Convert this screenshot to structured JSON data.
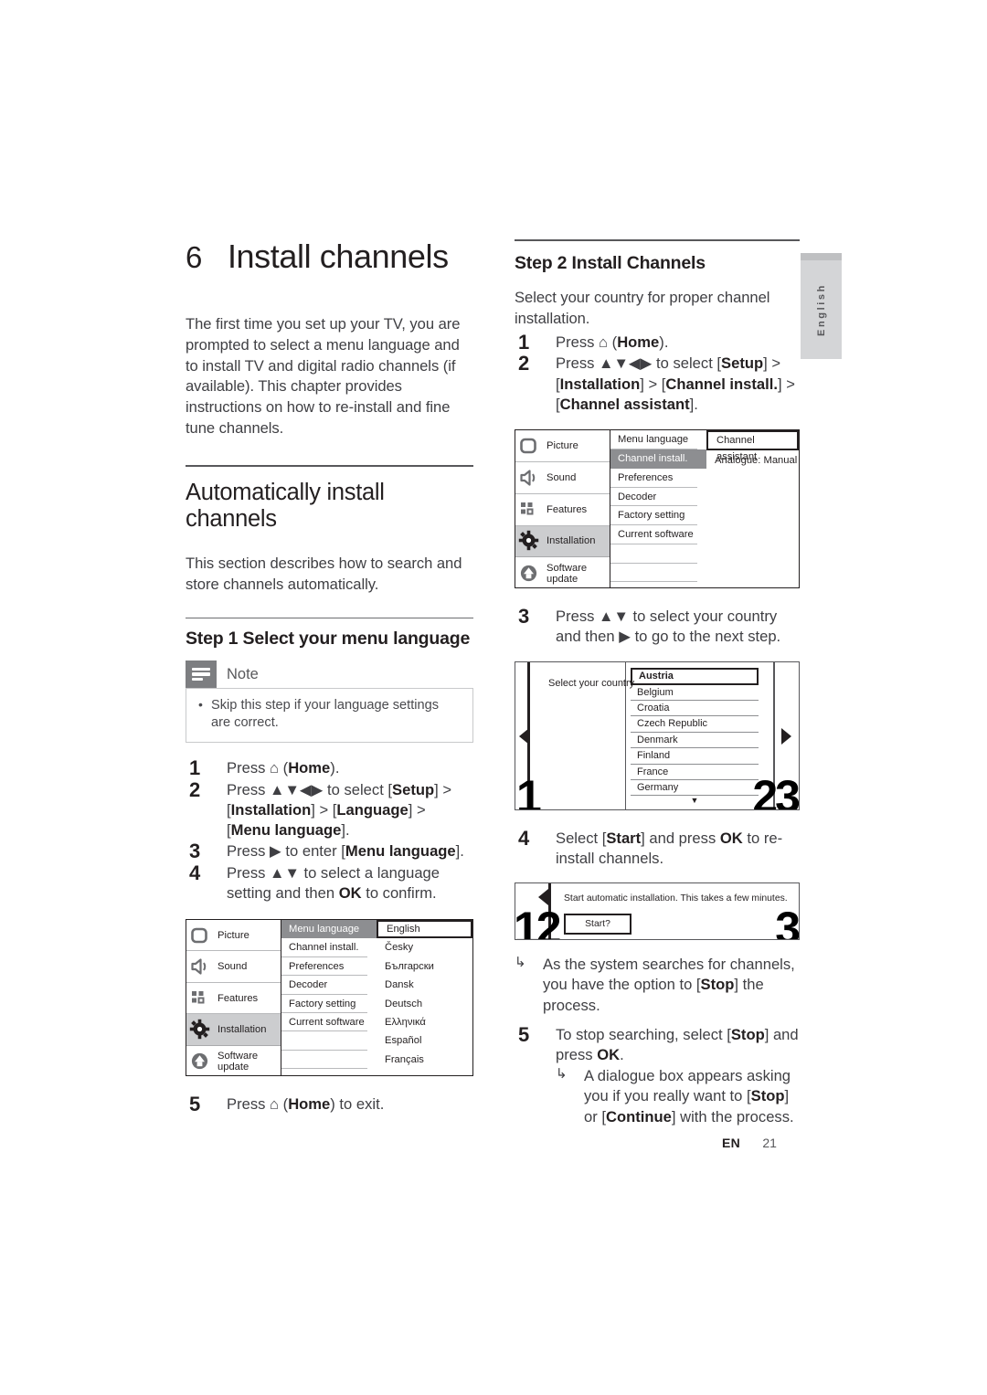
{
  "document": {
    "chapter_number": "6",
    "chapter_title": "Install channels",
    "intro": "The first time you set up your TV, you are prompted to select a menu language and to install TV and digital radio channels (if available). This chapter provides instructions on how to re-install and fine tune channels."
  },
  "left_column": {
    "section_title": "Automatically install channels",
    "section_intro": "This section describes how to search and store channels automatically.",
    "step_heading": "Step 1 Select your menu language",
    "note": {
      "label": "Note",
      "items": [
        "Skip this step if your language settings are correct."
      ]
    },
    "steps": [
      {
        "n": "1",
        "html": "Press ⌂ (<b>Home</b>)."
      },
      {
        "n": "2",
        "html": "Press ▲▼◀▶ to select [<b>Setup</b>] &gt; [<b>Installation</b>] &gt; [<b>Language</b>] &gt; [<b>Menu language</b>]."
      },
      {
        "n": "3",
        "html": "Press ▶ to enter [<b>Menu language</b>]."
      },
      {
        "n": "4",
        "html": "Press ▲▼ to select a language setting and then <b>OK</b> to confirm."
      }
    ],
    "final_step": {
      "n": "5",
      "html": "Press ⌂ (<b>Home</b>) to exit."
    }
  },
  "right_column": {
    "step_heading": "Step 2 Install Channels",
    "intro": "Select your country for proper channel installation.",
    "steps": [
      {
        "n": "1",
        "html": "Press ⌂ (<b>Home</b>)."
      },
      {
        "n": "2",
        "html": "Press ▲▼◀▶ to select [<b>Setup</b>] &gt; [<b>Installation</b>] &gt; [<b>Channel install.</b>] &gt; [<b>Channel assistant</b>]."
      }
    ],
    "step3": {
      "n": "3",
      "html": "Press ▲▼ to select your country and then ▶ to go to the next step."
    },
    "step4": {
      "n": "4",
      "html": "Select [<b>Start</b>] and press <b>OK</b> to re-install channels."
    },
    "bullet_after_4": "As the system searches for channels, you have the option to [<b>Stop</b>] the process.",
    "step5": {
      "n": "5",
      "html": "To stop searching, select [<b>Stop</b>] and press <b>OK</b>."
    },
    "bullet_after_5": "A dialogue box appears asking you if you really want to [<b>Stop</b>] or [<b>Continue</b>] with the process."
  },
  "tv_menu_language": {
    "nav": [
      {
        "label": "Picture",
        "icon": "picture-icon",
        "selected": false
      },
      {
        "label": "Sound",
        "icon": "speaker-icon",
        "selected": false
      },
      {
        "label": "Features",
        "icon": "features-icon",
        "selected": false
      },
      {
        "label": "Installation",
        "icon": "gear-icon",
        "selected": true
      },
      {
        "label": "Software update",
        "icon": "software-update-icon",
        "selected": false
      }
    ],
    "middle": [
      {
        "label": "Menu language",
        "selected": true
      },
      {
        "label": "Channel install.",
        "selected": false
      },
      {
        "label": "Preferences",
        "selected": false
      },
      {
        "label": "Decoder",
        "selected": false
      },
      {
        "label": "Factory setting",
        "selected": false
      },
      {
        "label": "Current software",
        "selected": false
      },
      {
        "label": "",
        "selected": false
      },
      {
        "label": "",
        "selected": false
      }
    ],
    "right": [
      {
        "label": "English",
        "selected": true
      },
      {
        "label": "Česky",
        "selected": false
      },
      {
        "label": "Български",
        "selected": false
      },
      {
        "label": "Dansk",
        "selected": false
      },
      {
        "label": "Deutsch",
        "selected": false
      },
      {
        "label": "Ελληνικά",
        "selected": false
      },
      {
        "label": "Español",
        "selected": false
      },
      {
        "label": "Français",
        "selected": false
      }
    ]
  },
  "tv_menu_install": {
    "nav": [
      {
        "label": "Picture",
        "icon": "picture-icon",
        "selected": false
      },
      {
        "label": "Sound",
        "icon": "speaker-icon",
        "selected": false
      },
      {
        "label": "Features",
        "icon": "features-icon",
        "selected": false
      },
      {
        "label": "Installation",
        "icon": "gear-icon",
        "selected": true
      },
      {
        "label": "Software update",
        "icon": "software-update-icon",
        "selected": false
      }
    ],
    "middle": [
      {
        "label": "Menu language",
        "selected": false
      },
      {
        "label": "Channel install.",
        "selected": true
      },
      {
        "label": "Preferences",
        "selected": false
      },
      {
        "label": "Decoder",
        "selected": false
      },
      {
        "label": "Factory setting",
        "selected": false
      },
      {
        "label": "Current software",
        "selected": false
      },
      {
        "label": "",
        "selected": false
      },
      {
        "label": "",
        "selected": false
      }
    ],
    "right": [
      {
        "label": "Channel assistant",
        "selected": true
      },
      {
        "label": "Analogue: Manual",
        "selected": false
      }
    ]
  },
  "tv_country": {
    "prompt": "Select your country",
    "countries": [
      {
        "label": "Austria",
        "selected": true
      },
      {
        "label": "Belgium",
        "selected": false
      },
      {
        "label": "Croatia",
        "selected": false
      },
      {
        "label": "Czech Republic",
        "selected": false
      },
      {
        "label": "Denmark",
        "selected": false
      },
      {
        "label": "Finland",
        "selected": false
      },
      {
        "label": "France",
        "selected": false
      },
      {
        "label": "Germany",
        "selected": false
      }
    ],
    "scroll_down_glyph": "▼",
    "overlay_number_left": "1",
    "overlay_number_right": "23"
  },
  "tv_start_dialog": {
    "message": "Start automatic installation. This takes a few minutes.",
    "button_label": "Start?",
    "overlay_number_left": "12",
    "overlay_number_right": "3"
  },
  "side_tab": {
    "label": "English"
  },
  "footer": {
    "language_code": "EN",
    "page_number": "21"
  },
  "colors": {
    "text": "#231f20",
    "body_text": "#3f3f43",
    "note_tab": "#7d7e81",
    "menu_selected": "#8d8e91",
    "nav_selected": "#cccdcf",
    "side_tab": "#d4d5d7"
  }
}
